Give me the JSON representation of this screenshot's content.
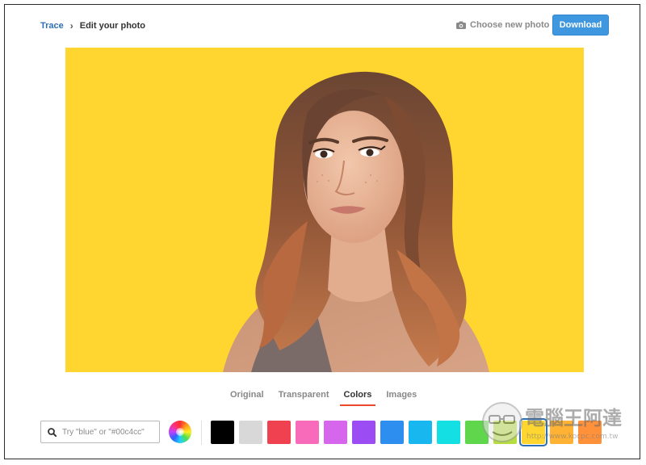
{
  "breadcrumb": {
    "root": "Trace",
    "separator": "›",
    "current": "Edit your photo"
  },
  "header": {
    "choose_label": "Choose new photo",
    "choose_icon": "camera-icon",
    "download_label": "Download"
  },
  "canvas": {
    "background_color": "#ffd630"
  },
  "tabs": [
    {
      "label": "Original",
      "active": false
    },
    {
      "label": "Transparent",
      "active": false
    },
    {
      "label": "Colors",
      "active": true
    },
    {
      "label": "Images",
      "active": false
    }
  ],
  "search": {
    "placeholder": "Try \"blue\" or \"#00c4cc\"",
    "value": "",
    "icon": "search-icon"
  },
  "swatches": [
    {
      "name": "black",
      "color": "#000000"
    },
    {
      "name": "light-gray",
      "color": "#d8d8d8"
    },
    {
      "name": "red",
      "color": "#ef4150"
    },
    {
      "name": "pink",
      "color": "#f76bba"
    },
    {
      "name": "orchid",
      "color": "#d667ec"
    },
    {
      "name": "purple",
      "color": "#9b4cf2"
    },
    {
      "name": "blue",
      "color": "#2e8ef0"
    },
    {
      "name": "sky-blue",
      "color": "#18b7ef"
    },
    {
      "name": "turquoise",
      "color": "#14dfe2"
    },
    {
      "name": "green",
      "color": "#5fd64b"
    },
    {
      "name": "yellow-green",
      "color": "#b6dd3e"
    },
    {
      "name": "yellow",
      "color": "#ffd630",
      "selected": true
    },
    {
      "name": "amber",
      "color": "#ffb233"
    },
    {
      "name": "orange",
      "color": "#ff913a"
    }
  ],
  "watermark": {
    "title": "電腦王阿達",
    "url": "http://www.kocpc.com.tw"
  }
}
